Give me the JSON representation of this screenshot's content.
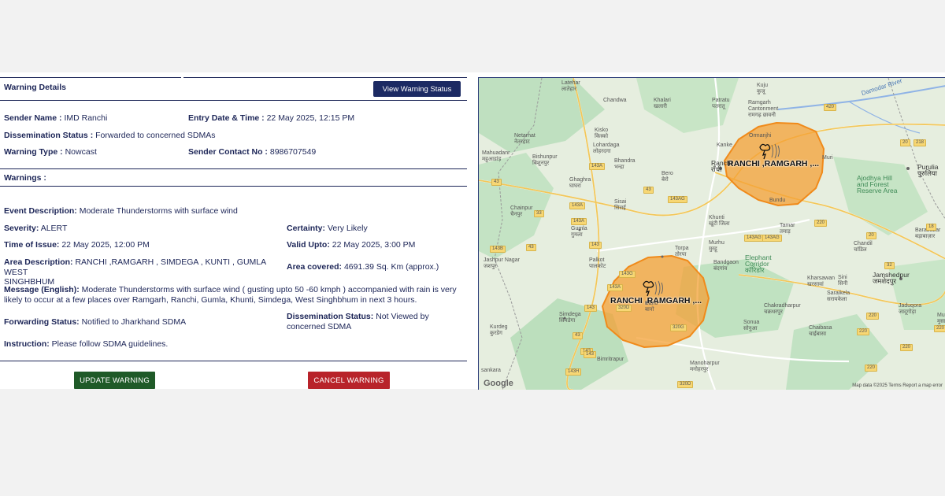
{
  "warning_details": {
    "title": "Warning Details",
    "view_status_button": "View Warning Status",
    "sender_name_label": "Sender Name :",
    "sender_name": "IMD Ranchi",
    "entry_label": "Entry Date & Time :",
    "entry_value": "22 May 2025, 12:15 PM",
    "dissemination_label": "Dissemination Status :",
    "dissemination_value": "Forwarded to concerned SDMAs",
    "type_label": "Warning Type :",
    "type_value": "Nowcast",
    "contact_label": "Sender Contact No :",
    "contact_value": "8986707549"
  },
  "warnings": {
    "title": "Warnings :",
    "event_label": "Event Description:",
    "event_value": "Moderate Thunderstorms with surface wind",
    "severity_label": "Severity:",
    "severity_value": "ALERT",
    "certainty_label": "Certainty:",
    "certainty_value": "Very Likely",
    "issue_label": "Time of Issue:",
    "issue_value": "22 May 2025, 12:00 PM",
    "valid_label": "Valid Upto:",
    "valid_value": "22 May 2025, 3:00 PM",
    "area_label": "Area Description:",
    "area_value_1": "RANCHI ,RAMGARH , SIMDEGA , KUNTI , GUMLA WEST",
    "area_value_2": "SINGHBHUM",
    "covered_label": "Area covered:",
    "covered_value": "4691.39 Sq. Km (approx.)",
    "message_label": "Message (English):",
    "message_value_1": "Moderate Thunderstorms with surface wind ( gusting upto 50 -60 kmph ) accompanied with rain is very",
    "message_value_2": "likely to occur at a few places over Ramgarh, Ranchi, Gumla, Khunti, Simdega, West Singhbhum in next 3 hours.",
    "forwarding_label": "Forwarding Status:",
    "forwarding_value": "Notified to Jharkhand SDMA",
    "diss_label": "Dissemination Status:",
    "diss_value_1": "Not Viewed by",
    "diss_value_2": "concerned SDMA",
    "instruction_label": "Instruction:",
    "instruction_value": "Please follow SDMA guidelines."
  },
  "actions": {
    "update": "UPDATE WARNING",
    "cancel": "CANCEL WARNING"
  },
  "map": {
    "polygon_label_1": "RANCHI ,RAMGARH ,...",
    "polygon_label_2": "RANCHI ,RAMGARH ,...",
    "google": "Google",
    "attribution": "Map data ©2025   Terms   Report a map error",
    "polygon_color": "#f4a035",
    "places": {
      "latehar": "Latehar\nलातेहार",
      "chandwa": "Chandwa",
      "khalari": "Khalari\nखलारी",
      "patratu": "Patratu\nपतरातू",
      "kuju": "Kuju\nकुजू",
      "ramgarh": "Ramgarh\nCantonment\nरामगढ़ छावनी",
      "damodar": "Damodar River",
      "netarhat": "Netarhat\nनेतरहाट",
      "kisko": "Kisko\nकिस्को",
      "lohardaga": "Lohardaga\nलोहरदगा",
      "ormanjhi": "Ormanjhi",
      "mahuadanr": "Mahuadanr\nमहुआडांड़",
      "bishunpur": "Bishunpur\nबिशुनपुर",
      "bhandra": "Bhandra\nभन्द्रा",
      "kanke": "Kanke",
      "ranchi": "Ranchi\nराँची",
      "bero": "Bero\nबेरो",
      "ghaghra": "Ghaghra\nघाघरा",
      "purulia": "Purulia\nपुरुलिया",
      "ajodhya": "Ajodhya Hill\nand Forest\nReserve Area",
      "chainpur": "Chainpur\nचैनपुर",
      "sisai": "Sisai\nसिसई",
      "gumla": "Gumla\nगुमला",
      "khunti": "Khunti\nखूंटी जिला",
      "tamar": "Tamar\nतमाड़",
      "barabazar": "Barabazar\nबड़ाबाज़ार",
      "murhu": "Murhu\nमुरहू",
      "jashpur": "Jashpur Nagar\nजशपुर",
      "palkot": "Palkot\nपालकोट",
      "torpa": "Torpa\nतोरपा",
      "elephant": "Elephant\nCorridor\nकॉरिडोर",
      "bandgaon": "Bandgaon\nबंदगांव",
      "chandil": "Chandil\nचांडिल",
      "jamshedpur": "Jamshedpur\nजमशेदपुर",
      "kharsawan": "Kharsawan\nखरसावां",
      "sini": "Sini\nसिनी",
      "saraikela": "Saraikela\nसरायकेला",
      "jaduqora": "Jaduqora\nजादूगोड़ा",
      "simdega": "Simdega\nसिमडेगा",
      "chakradharpur": "Chakradharpur\nचक्रधरपुर",
      "kurdeg": "Kurdeg\nकुरडेग",
      "sonua": "Sonua\nसोनुआ",
      "chaibasa": "Chaibasa\nचाईबासा",
      "bano": "Bano\nबानो",
      "bimritrapur": "Bimritrapur",
      "manoharpur": "Manoharpur\nमनोहरपुर",
      "sankara": "sankara",
      "muri": "Muri",
      "bundu": "Bundu",
      "musa": "Musa\nमुसा"
    },
    "roads": [
      "43",
      "420",
      "143A",
      "143A",
      "33",
      "43",
      "143AG",
      "143B",
      "143A",
      "143",
      "43",
      "143G",
      "143A",
      "143",
      "143",
      "43",
      "20",
      "32",
      "143AG",
      "20",
      "218",
      "18",
      "220",
      "220",
      "220",
      "220",
      "320D",
      "320G",
      "320D",
      "220",
      "143H",
      "143",
      "220",
      "143AG"
    ]
  }
}
